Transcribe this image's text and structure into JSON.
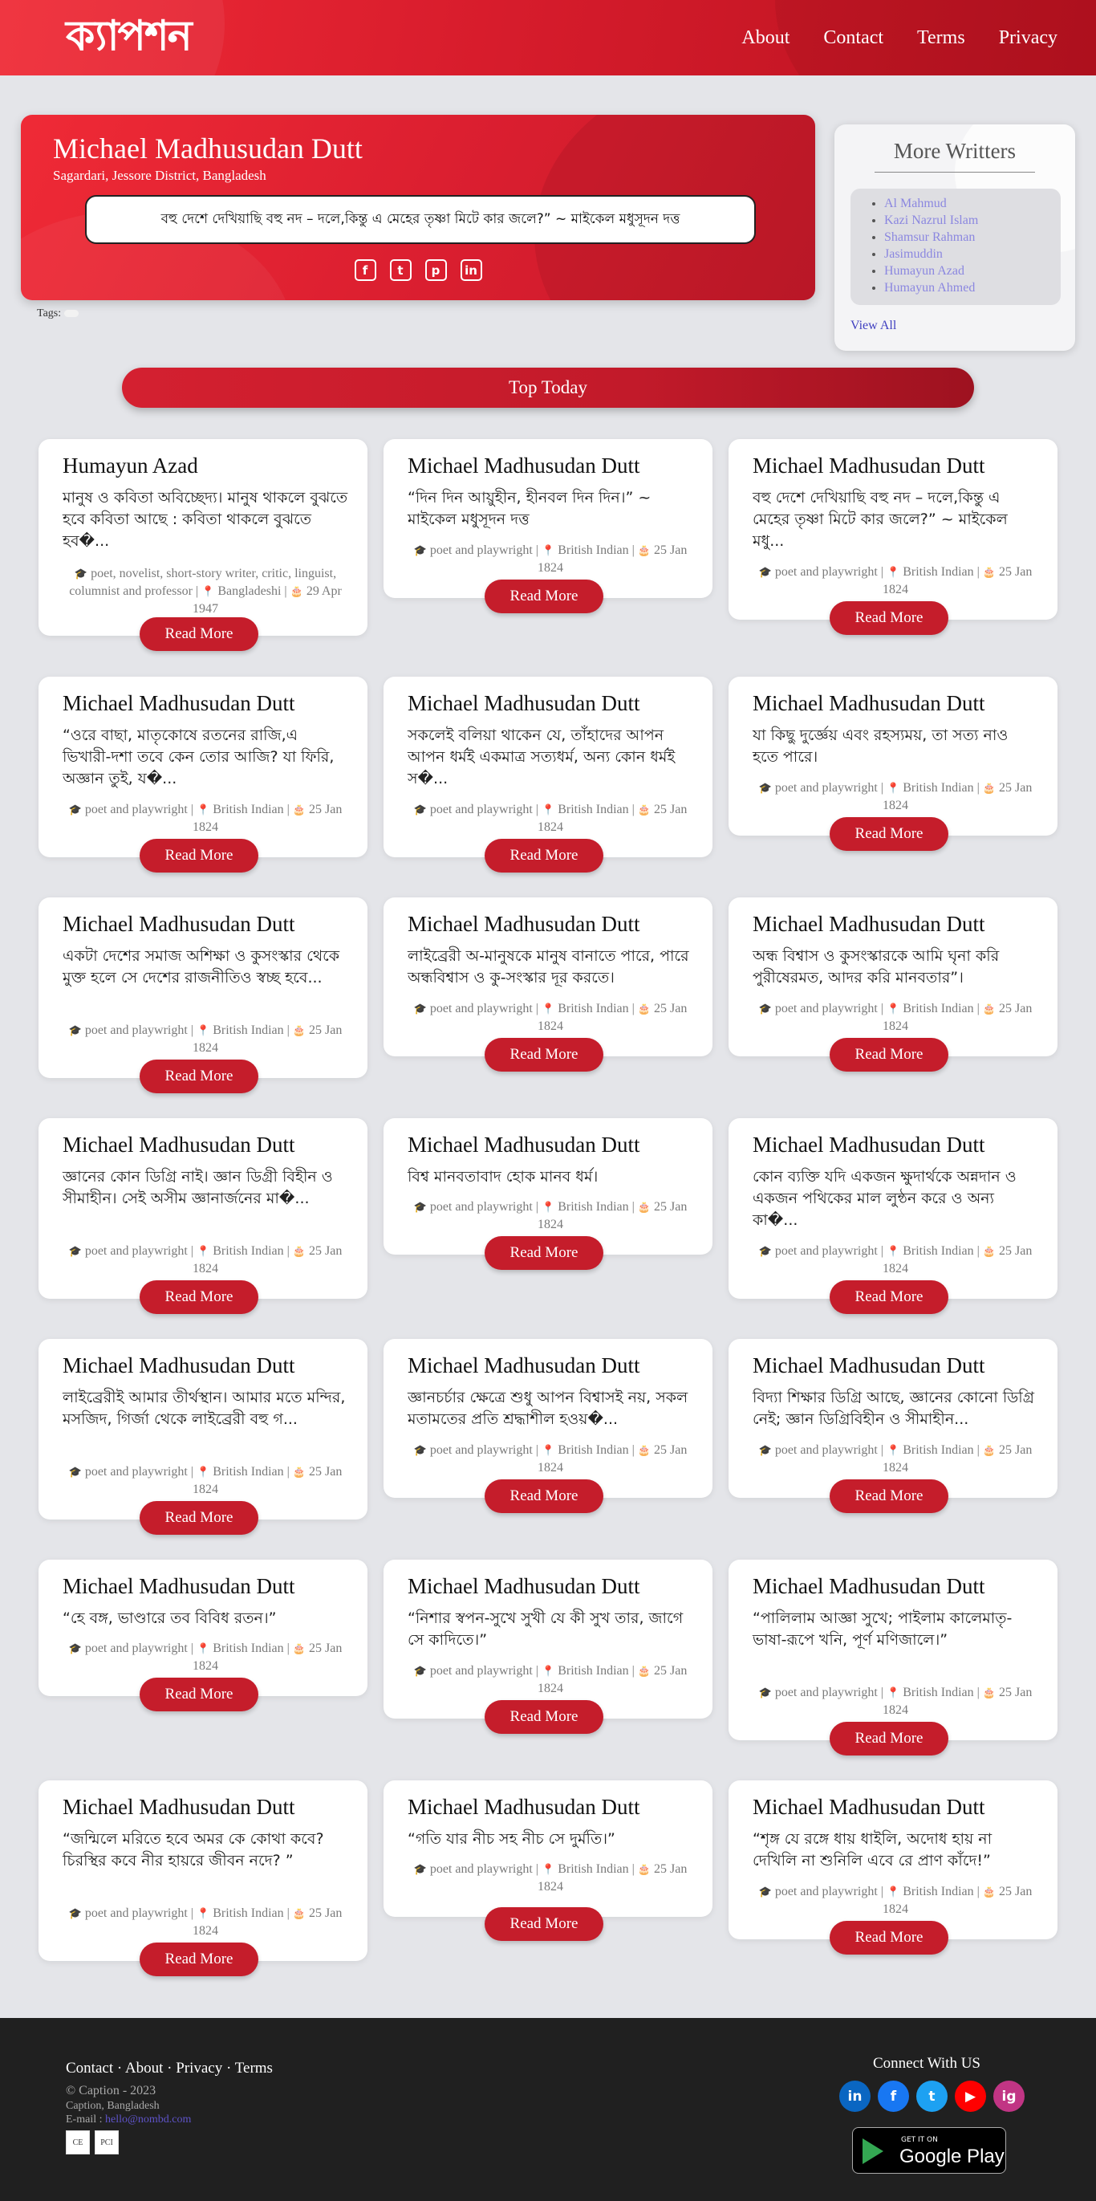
{
  "header": {
    "logo": "ক্যাপশন",
    "nav": [
      "About",
      "Contact",
      "Terms",
      "Privacy"
    ]
  },
  "hero": {
    "name": "Michael Madhusudan Dutt",
    "place": "Sagardari, Jessore District, Bangladesh",
    "quote": "বহু দেশে দেখিয়াছি বহু নদ – দলে,কিন্তু এ মেহের তৃষ্ণা মিটে কার জলে?” ~ মাইকেল মধুসূদন দত্ত",
    "social": [
      "f",
      "t",
      "p",
      "in"
    ],
    "tags_label": "Tags:"
  },
  "sidebar": {
    "title": "More Writters",
    "writers": [
      "Al Mahmud",
      "Kazi Nazrul Islam",
      "Shamsur Rahman",
      "Jasimuddin",
      "Humayun Azad",
      "Humayun Ahmed"
    ],
    "view_all": "View All"
  },
  "top_today": "Top Today",
  "meta_mmd": {
    "profession": "poet and playwright",
    "nationality": "British Indian",
    "birth": "25 Jan 1824"
  },
  "read_more": "Read More",
  "cards": [
    {
      "name": "Humayun Azad",
      "quote": "মানুষ ও কবিতা অবিচ্ছেদ্য। মানুষ থাকলে বুঝতে হবে কবিতা আছে : কবিতা থাকলে বুঝতে হব�...",
      "profession": "poet, novelist, short-story writer, critic, linguist, columnist and professor",
      "nationality": "Bangladeshi",
      "birth": "29 Apr 1947"
    },
    {
      "name": "Michael Madhusudan Dutt",
      "quote": "“দিন দিন আয়ুহীন, হীনবল দিন দিন।” ~ মাইকেল মধুসূদন দত্ত"
    },
    {
      "name": "Michael Madhusudan Dutt",
      "quote": "বহু দেশে দেখিয়াছি বহু নদ – দলে,কিন্তু এ মেহের তৃষ্ণা মিটে কার জলে?” ~ মাইকেল মধু..."
    },
    {
      "name": "Michael Madhusudan Dutt",
      "quote": "“ওরে বাছা, মাতৃকোষে রতনের রাজি,এ ভিখারী-দশা তবে কেন তোর আজি? যা ফিরি, অজ্ঞান তুই, য�..."
    },
    {
      "name": "Michael Madhusudan Dutt",
      "quote": "সকলেই বলিয়া থাকেন যে, তাঁহাদের আপন আপন ধর্মই একমাত্র সত্যধর্ম, অন্য কোন ধর্মই স�..."
    },
    {
      "name": "Michael Madhusudan Dutt",
      "quote": "যা কিছু দুর্জ্ঞেয় এবং রহস্যময়, তা সত্য নাও হতে পারে।"
    },
    {
      "name": "Michael Madhusudan Dutt",
      "quote": "একটা দেশের সমাজ অশিক্ষা ও কুসংস্কার থেকে মুক্ত হলে সে দেশের রাজনীতিও স্বচ্ছ হবে..."
    },
    {
      "name": "Michael Madhusudan Dutt",
      "quote": "লাইব্রেরী অ-মানুষকে মানুষ বানাতে পারে, পারে অন্ধবিশ্বাস ও কু-সংস্কার দূর করতে।"
    },
    {
      "name": "Michael Madhusudan Dutt",
      "quote": "অন্ধ বিশ্বাস ও কুসংস্কারকে আমি ঘৃনা করি পুরীষেরমত, আদর করি মানবতার”।"
    },
    {
      "name": "Michael Madhusudan Dutt",
      "quote": "জ্ঞানের কোন ডিগ্রি নাই। জ্ঞান ডিগ্রী বিহীন ও সীমাহীন। সেই অসীম জ্ঞানার্জনের মা�..."
    },
    {
      "name": "Michael Madhusudan Dutt",
      "quote": "বিশ্ব মানবতাবাদ হোক মানব ধর্ম।"
    },
    {
      "name": "Michael Madhusudan Dutt",
      "quote": "কোন ব্যক্তি যদি একজন ক্ষুদার্থকে অন্নদান ও একজন পথিকের মাল লুন্ঠন করে ও অন্য কা�..."
    },
    {
      "name": "Michael Madhusudan Dutt",
      "quote": "লাইব্রেরীই আমার তীর্থস্থান। আমার মতে মন্দির, মসজিদ, গির্জা থেকে লাইব্রেরী বহু গ..."
    },
    {
      "name": "Michael Madhusudan Dutt",
      "quote": "জ্ঞানচর্চার ক্ষেত্রে শুধু আপন বিশ্বাসই নয়, সকল মতামতের প্রতি শ্রদ্ধাশীল হওয়�..."
    },
    {
      "name": "Michael Madhusudan Dutt",
      "quote": "বিদ্যা শিক্ষার ডিগ্রি আছে, জ্ঞানের কোনো ডিগ্রি নেই; জ্ঞান ডিগ্রিবিহীন ও সীমাহীন..."
    },
    {
      "name": "Michael Madhusudan Dutt",
      "quote": "“হে বঙ্গ, ভাণ্ডারে তব বিবিধ রতন।”"
    },
    {
      "name": "Michael Madhusudan Dutt",
      "quote": "“নিশার স্বপন-সুখে সুখী যে কী সুখ তার, জাগে সে কাদিতে।”"
    },
    {
      "name": "Michael Madhusudan Dutt",
      "quote": "“পালিলাম আজ্ঞা সুখে; পাইলাম কালেমাতৃ-ভাষা-রূপে খনি, পূর্ণ মণিজালে।”"
    },
    {
      "name": "Michael Madhusudan Dutt",
      "quote": "“জন্মিলে মরিতে হবে অমর কে কোথা কবে? চিরস্থির কবে নীর হায়রে জীবন নদে? ”"
    },
    {
      "name": "Michael Madhusudan Dutt",
      "quote": "“গতি যার নীচ সহ নীচ সে দুর্মতি।”"
    },
    {
      "name": "Michael Madhusudan Dutt",
      "quote": "“শৃঙ্গ যে রঙ্গে ধায় ধাইলি, অদোধ হায় না দেখিলি না শুনিলি এবে রে প্রাণ কাঁদে!”"
    }
  ],
  "footer": {
    "links": "Contact · About · Privacy · Terms",
    "copyright": "© Caption - 2023",
    "location": "Caption, Bangladesh",
    "email_label": "E-mail : ",
    "email": "hello@nombd.com",
    "badges": [
      "CE",
      "PCI"
    ],
    "connect": "Connect With US",
    "social": [
      "in",
      "f",
      "t",
      "▶",
      "ig"
    ],
    "social_colors": [
      "#0a66c2",
      "#1877f2",
      "#1da1f2",
      "#ff0000",
      "#c13584"
    ],
    "gplay_small": "GET IT ON",
    "gplay_big": "Google Play"
  }
}
